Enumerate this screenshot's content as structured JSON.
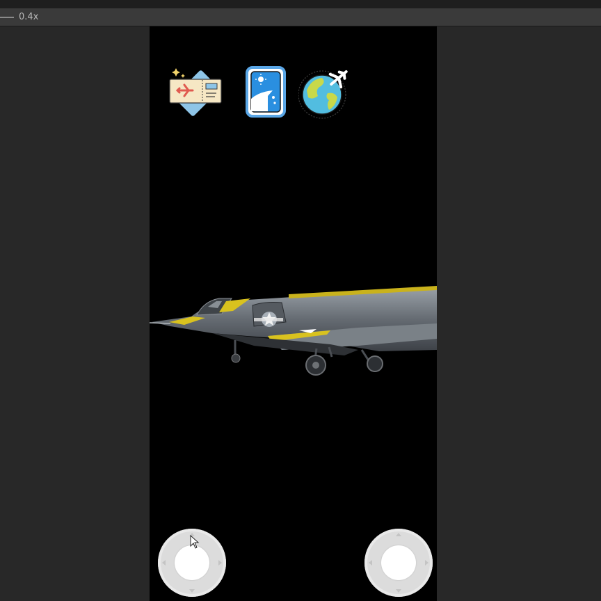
{
  "toolbar": {
    "zoom_label": "0.4x"
  },
  "game": {
    "hud_icons": [
      {
        "name": "ticket-icon"
      },
      {
        "name": "airplane-window-icon"
      },
      {
        "name": "globe-plane-icon"
      }
    ],
    "aircraft": {
      "name": "jet-fighter-model"
    },
    "joysticks": [
      {
        "name": "left-joystick"
      },
      {
        "name": "right-joystick"
      }
    ]
  },
  "colors": {
    "app_background": "#262626",
    "toolbar": "#3a3a3a",
    "viewport": "#000000",
    "jet_yellow": "#d9c21e",
    "jet_gray": "#6f757c",
    "joystick_ring": "#dcdcdc",
    "joystick_knob": "#ffffff"
  }
}
